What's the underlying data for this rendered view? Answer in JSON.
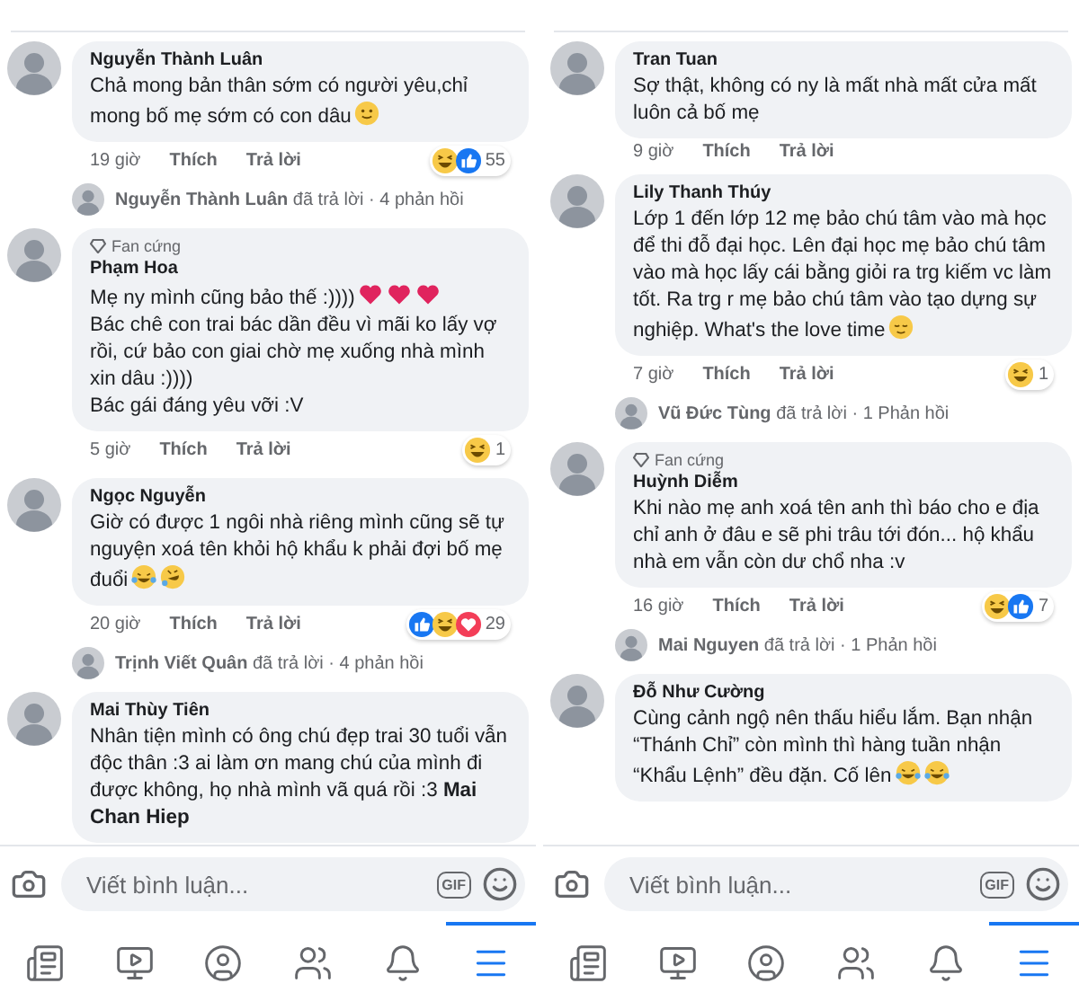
{
  "panels": [
    {
      "comments": [
        {
          "author": "Nguyễn Thành Luân",
          "paragraphs": [
            {
              "text": "Chả mong bản thân sớm có người yêu,chỉ mong bố mẹ sớm có con dâu",
              "emojis": [
                {
                  "kind": "smile"
                }
              ]
            }
          ],
          "time": "19 giờ",
          "like": "Thích",
          "reply": "Trả lời",
          "reactions": {
            "kinds": [
              {
                "kind": "haha"
              },
              {
                "kind": "like"
              }
            ],
            "count": "55"
          },
          "reply_summary": "**Nguyễn Thành Luân** đã trả lời · 4 phản hồi"
        },
        {
          "badge": "Fan cứng",
          "author": "Phạm Hoa",
          "paragraphs": [
            {
              "text": "Mẹ ny mình cũng bảo thế :))))",
              "emojis": [
                {
                  "kind": "heart"
                },
                {
                  "kind": "heart"
                },
                {
                  "kind": "heart"
                }
              ]
            },
            {
              "text": "Bác chê con trai bác dần đều vì mãi ko lấy vợ rồi, cứ bảo con giai chờ mẹ xuống nhà mình xin dâu :))))"
            },
            {
              "text": "Bác gái đáng yêu vỡi :V"
            }
          ],
          "time": "5 giờ",
          "like": "Thích",
          "reply": "Trả lời",
          "reactions": {
            "kinds": [
              {
                "kind": "haha"
              }
            ],
            "count": "1"
          }
        },
        {
          "author": "Ngọc Nguyễn",
          "paragraphs": [
            {
              "text": "Giờ có được 1 ngôi nhà riêng mình cũng sẽ tự nguyện xoá tên khỏi hộ khẩu k phải đợi bố mẹ đuổi",
              "emojis": [
                {
                  "kind": "joy"
                },
                {
                  "kind": "rofl"
                }
              ]
            }
          ],
          "time": "20 giờ",
          "like": "Thích",
          "reply": "Trả lời",
          "reactions": {
            "kinds": [
              {
                "kind": "like"
              },
              {
                "kind": "haha"
              },
              {
                "kind": "love"
              }
            ],
            "count": "29"
          },
          "reply_summary": "**Trịnh Viết Quân** đã trả lời · 4 phản hồi"
        },
        {
          "author": "Mai Thùy Tiên",
          "paragraphs": [
            {
              "text": "Nhân tiện mình có ông chú đẹp trai 30 tuổi vẫn độc thân :3 ai làm ơn mang chú của mình đi được không, họ nhà mình vã quá rồi :3 **Mai Chan Hiep**"
            }
          ]
        }
      ],
      "composer": {
        "placeholder": "Viết bình luận...",
        "gif": "GIF"
      },
      "nav": [
        {
          "selected": false
        },
        {
          "selected": false
        },
        {
          "selected": false
        },
        {
          "selected": false
        },
        {
          "selected": false
        },
        {
          "selected": true
        }
      ]
    },
    {
      "comments": [
        {
          "author": "Tran Tuan",
          "paragraphs": [
            {
              "text": "Sợ thật, không có ny là mất nhà mất cửa mất luôn cả bố mẹ"
            }
          ],
          "time": "9 giờ",
          "like": "Thích",
          "reply": "Trả lời"
        },
        {
          "author": "Lily Thanh Thúy",
          "paragraphs": [
            {
              "text": "Lớp 1 đến lớp 12 mẹ bảo chú tâm vào mà học để thi đỗ đại học. Lên đại học mẹ bảo chú tâm vào mà học lấy cái bằng giỏi ra trg kiếm vc làm tốt. Ra trg r mẹ bảo chú tâm vào tạo dựng sự nghiệp. What's the love time",
              "emojis": [
                {
                  "kind": "relieved"
                }
              ]
            }
          ],
          "time": "7 giờ",
          "like": "Thích",
          "reply": "Trả lời",
          "reactions": {
            "kinds": [
              {
                "kind": "haha"
              }
            ],
            "count": "1"
          },
          "reply_summary": "**Vũ Đức Tùng** đã trả lời · 1 Phản hồi"
        },
        {
          "badge": "Fan cứng",
          "author": "Huỳnh Diễm",
          "paragraphs": [
            {
              "text": "Khi nào mẹ anh xoá tên anh thì báo cho e địa chỉ anh ở đâu e sẽ phi trâu tới đón... hộ khẩu nhà em vẫn còn dư chổ nha :v"
            }
          ],
          "time": "16 giờ",
          "like": "Thích",
          "reply": "Trả lời",
          "reactions": {
            "kinds": [
              {
                "kind": "haha"
              },
              {
                "kind": "like"
              }
            ],
            "count": "7"
          },
          "reply_summary": "**Mai Nguyen** đã trả lời · 1 Phản hồi"
        },
        {
          "author": "Đỗ Như Cường",
          "paragraphs": [
            {
              "text": "Cùng cảnh ngộ nên thấu hiểu lắm. Bạn nhận “Thánh Chỉ” còn mình thì hàng tuần nhận “Khẩu Lệnh” đều đặn. Cố lên",
              "emojis": [
                {
                  "kind": "joy"
                },
                {
                  "kind": "joy"
                }
              ]
            }
          ]
        }
      ],
      "composer": {
        "placeholder": "Viết bình luận...",
        "gif": "GIF"
      },
      "nav": [
        {
          "selected": false
        },
        {
          "selected": false
        },
        {
          "selected": false
        },
        {
          "selected": false
        },
        {
          "selected": false
        },
        {
          "selected": true
        }
      ]
    }
  ]
}
